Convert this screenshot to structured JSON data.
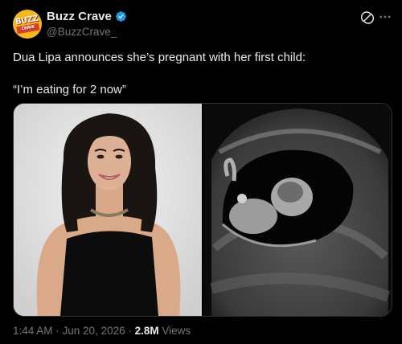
{
  "author": {
    "avatar_text": "BUZZ",
    "avatar_sub": "CRAVE",
    "name": "Buzz Crave",
    "handle": "@BuzzCrave_"
  },
  "tweet": {
    "line1": "Dua Lipa announces she’s pregnant with her first child:",
    "line2": "“I’m eating for 2 now”"
  },
  "meta": {
    "time": "1:44 AM",
    "sep1": " · ",
    "date": "Jun 20, 2026",
    "sep2": " · ",
    "views_count": "2.8M",
    "views_label": " Views"
  },
  "icons": {
    "verified": "verified-badge-icon",
    "grok": "grok-icon",
    "more": "more-icon"
  },
  "colors": {
    "background": "#000000",
    "text": "#e7e9ea",
    "muted": "#71767b",
    "verified": "#1d9bf0",
    "avatar": "#f6b81c"
  }
}
